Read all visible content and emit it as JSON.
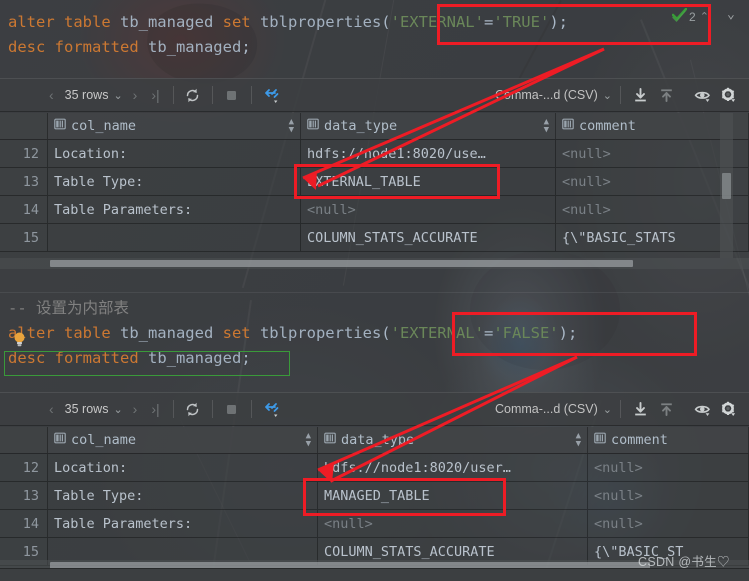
{
  "editor_top": {
    "lines": [
      [
        {
          "t": "alter table ",
          "c": "kw"
        },
        {
          "t": "tb_managed ",
          "c": "id"
        },
        {
          "t": "set ",
          "c": "kw"
        },
        {
          "t": "tblproperties",
          "c": "id"
        },
        {
          "t": "(",
          "c": "pun"
        },
        {
          "t": "'EXTERNAL'",
          "c": "str"
        },
        {
          "t": "=",
          "c": "pun"
        },
        {
          "t": "'TRUE'",
          "c": "str"
        },
        {
          "t": ")",
          "c": "pun"
        },
        {
          "t": ";",
          "c": "pun"
        }
      ],
      [
        {
          "t": "desc formatted ",
          "c": "kw"
        },
        {
          "t": "tb_managed",
          "c": "id"
        },
        {
          "t": ";",
          "c": "pun"
        }
      ]
    ]
  },
  "editor_bottom": {
    "lines": [
      [
        {
          "t": "-- 设置为内部表",
          "c": "cmt"
        }
      ],
      [
        {
          "t": "alter table ",
          "c": "kw"
        },
        {
          "t": "tb_managed ",
          "c": "id"
        },
        {
          "t": "set ",
          "c": "kw"
        },
        {
          "t": "tblproperties",
          "c": "id"
        },
        {
          "t": "(",
          "c": "pun"
        },
        {
          "t": "'EXTERNAL'",
          "c": "str"
        },
        {
          "t": "=",
          "c": "pun"
        },
        {
          "t": "'FALSE'",
          "c": "str"
        },
        {
          "t": ")",
          "c": "pun"
        },
        {
          "t": ";",
          "c": "pun"
        }
      ],
      [
        {
          "t": "desc formatted ",
          "c": "kw"
        },
        {
          "t": "tb_managed",
          "c": "id"
        },
        {
          "t": ";",
          "c": "pun"
        }
      ]
    ]
  },
  "inspections": {
    "count": "2",
    "check_icon": "green-check-icon",
    "up_arrow": "⌃",
    "chevron": "⌄"
  },
  "toolbar": {
    "prev_page": "‹",
    "rows_label": "35 rows",
    "rows_caret": "⌄",
    "next_page": "›",
    "last_page": "›|",
    "refresh_icon": "refresh-icon",
    "stop_icon": "stop-icon",
    "transpose_icon": "transpose-icon",
    "format_label": "Comma-...d (CSV)",
    "format_caret": "⌄",
    "download_icon": "download-icon",
    "upload_icon": "upload-icon",
    "view_icon": "eye-icon",
    "settings_icon": "gear-icon"
  },
  "grid": {
    "headers": [
      {
        "label": "col_name",
        "icon": "column-icon",
        "sortable": true
      },
      {
        "label": "data_type",
        "icon": "column-icon",
        "sortable": true
      },
      {
        "label": "comment",
        "icon": "column-icon",
        "sortable": false
      }
    ],
    "rows_top": [
      {
        "n": "12",
        "col_name": "Location:",
        "data_type": "hdfs://node1:8020/use…",
        "comment": "<null>",
        "comment_null": true
      },
      {
        "n": "13",
        "col_name": "Table Type:",
        "data_type": "EXTERNAL_TABLE",
        "comment": "<null>",
        "comment_null": true
      },
      {
        "n": "14",
        "col_name": "Table Parameters:",
        "data_type": "<null>",
        "comment": "<null>",
        "comment_null": true,
        "data_type_null": true
      },
      {
        "n": "15",
        "col_name": "",
        "data_type": "COLUMN_STATS_ACCURATE",
        "comment": "{\\\"BASIC_STATS"
      }
    ],
    "rows_bottom": [
      {
        "n": "12",
        "col_name": "Location:",
        "data_type": "hdfs://node1:8020/user…",
        "comment": "<null>",
        "comment_null": true
      },
      {
        "n": "13",
        "col_name": "Table Type:",
        "data_type": "MANAGED_TABLE",
        "comment": "<null>",
        "comment_null": true
      },
      {
        "n": "14",
        "col_name": "Table Parameters:",
        "data_type": "<null>",
        "comment": "<null>",
        "comment_null": true,
        "data_type_null": true
      },
      {
        "n": "15",
        "col_name": "",
        "data_type": "COLUMN_STATS_ACCURATE",
        "comment": "{\\\"BASIC_ST"
      }
    ]
  },
  "annotations": {
    "highlight_color": "#ee1c25",
    "selection_color": "#3a9a3a",
    "note": "red boxes highlight EXTERNAL TRUE/FALSE and resulting table type"
  },
  "watermark": {
    "text": "CSDN @书生♡"
  }
}
